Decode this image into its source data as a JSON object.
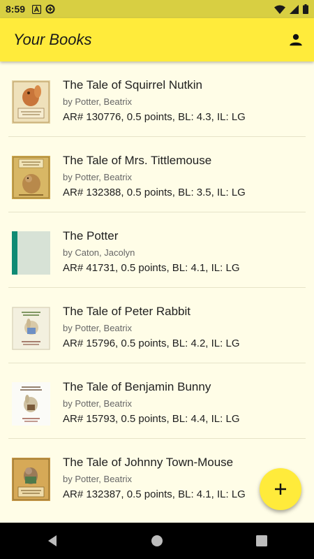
{
  "status_bar": {
    "time": "8:59"
  },
  "app_bar": {
    "title": "Your Books"
  },
  "books": [
    {
      "title": "The Tale of Squirrel Nutkin",
      "author": "by Potter, Beatrix",
      "meta": "AR# 130776, 0.5 points, BL: 4.3, IL: LG"
    },
    {
      "title": "The Tale of Mrs. Tittlemouse",
      "author": "by Potter, Beatrix",
      "meta": "AR# 132388, 0.5 points, BL: 3.5, IL: LG"
    },
    {
      "title": "The Potter",
      "author": "by Caton, Jacolyn",
      "meta": "AR# 41731, 0.5 points, BL: 4.1, IL: LG"
    },
    {
      "title": "The Tale of Peter Rabbit",
      "author": "by Potter, Beatrix",
      "meta": "AR# 15796, 0.5 points, BL: 4.2, IL: LG"
    },
    {
      "title": "The Tale of Benjamin Bunny",
      "author": "by Potter, Beatrix",
      "meta": "AR# 15793, 0.5 points, BL: 4.4, IL: LG"
    },
    {
      "title": "The Tale of Johnny Town-Mouse",
      "author": "by Potter, Beatrix",
      "meta": "AR# 132387, 0.5 points, BL: 4.1, IL: LG"
    }
  ],
  "icons": {
    "account": "account-icon",
    "add": "add-icon",
    "back": "back-icon",
    "home": "home-icon",
    "recents": "recents-icon"
  },
  "colors": {
    "app_bar": "#ffeb3b",
    "status_bar": "#d8cf42",
    "background": "#fffde7",
    "fab": "#ffeb3b"
  }
}
